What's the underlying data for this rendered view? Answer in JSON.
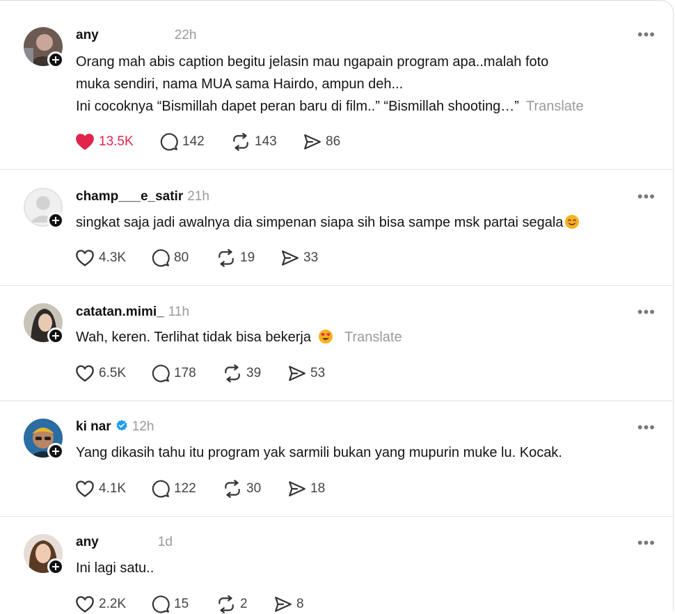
{
  "posts": [
    {
      "username": "any",
      "time": "22h",
      "lines": [
        "Orang mah abis caption begitu jelasin mau ngapain program apa..malah foto",
        "muka sendiri, nama MUA sama Hairdo, ampun deh...",
        "Ini cocoknya “Bismillah dapet peran baru di film..” “Bismillah shooting…”"
      ],
      "translate": "Translate",
      "liked": true,
      "likes": "13.5K",
      "replies": "142",
      "reposts": "143",
      "shares": "86"
    },
    {
      "username": "champ___e_satir",
      "time": "21h",
      "lines": [
        "singkat saja jadi awalnya dia simpenan siapa sih bisa sampe msk partai segala"
      ],
      "emoji": "smile",
      "likes": "4.3K",
      "replies": "80",
      "reposts": "19",
      "shares": "33"
    },
    {
      "username": "catatan.mimi_",
      "time": "11h",
      "lines": [
        "Wah, keren. Terlihat tidak bisa bekerja"
      ],
      "emoji": "heart-eyes",
      "translate": "Translate",
      "likes": "6.5K",
      "replies": "178",
      "reposts": "39",
      "shares": "53"
    },
    {
      "username": "ki nar",
      "time": "12h",
      "verified": true,
      "lines": [
        "Yang dikasih tahu itu program yak sarmili bukan yang mupurin muke lu. Kocak."
      ],
      "likes": "4.1K",
      "replies": "122",
      "reposts": "30",
      "shares": "18"
    },
    {
      "username": "any ",
      "time": "1d",
      "lines": [
        "Ini lagi satu.."
      ],
      "likes": "2.2K",
      "replies": "15",
      "reposts": "2",
      "shares": "8"
    }
  ],
  "more_label": "•••",
  "icons": {
    "like": "heart-icon",
    "reply": "reply-bubble-icon",
    "repost": "repost-icon",
    "share": "share-icon",
    "more": "more-dots-icon",
    "follow": "follow-plus-icon",
    "verified": "verified-badge-icon"
  },
  "colors": {
    "like_active": "#e0244b",
    "muted": "#9a9a9a",
    "verified": "#1d9bf0"
  }
}
